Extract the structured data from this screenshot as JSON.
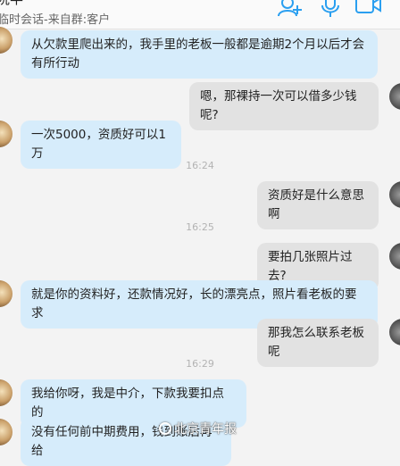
{
  "header": {
    "title": "阮半",
    "subtitle": "临时会话-来自群:客户",
    "icons": [
      "add-contact-icon",
      "microphone-icon",
      "video-call-icon"
    ],
    "accent_color": "#2a9ff0"
  },
  "messages": [
    {
      "side": "in",
      "text": "从欠款里爬出来的，我手里的老板一般都是逾期2个月以后才会有所行动"
    },
    {
      "side": "out",
      "text": "嗯，那裸持一次可以借多少钱呢?"
    },
    {
      "side": "in",
      "text": "一次5000，资质好可以1万"
    },
    {
      "side": "out",
      "text": "资质好是什么意思啊"
    },
    {
      "side": "out",
      "text": "要拍几张照片过去?"
    },
    {
      "side": "in",
      "text": "就是你的资料好，还款情况好，长的漂亮点，照片看老板的要求"
    },
    {
      "side": "out",
      "text": "那我怎么联系老板呢"
    },
    {
      "side": "in",
      "text": "我给你呀，我是中介，下款我要扣点的"
    },
    {
      "side": "in",
      "text": "没有任何前中期费用，钱到账后再给"
    }
  ],
  "timestamps": [
    "16:24",
    "16:25",
    "16:29"
  ],
  "watermark": "北京青年报",
  "colors": {
    "incoming_bubble": "#d6ecfb",
    "outgoing_bubble": "#e2e2e2",
    "background": "#f3f3f3"
  }
}
